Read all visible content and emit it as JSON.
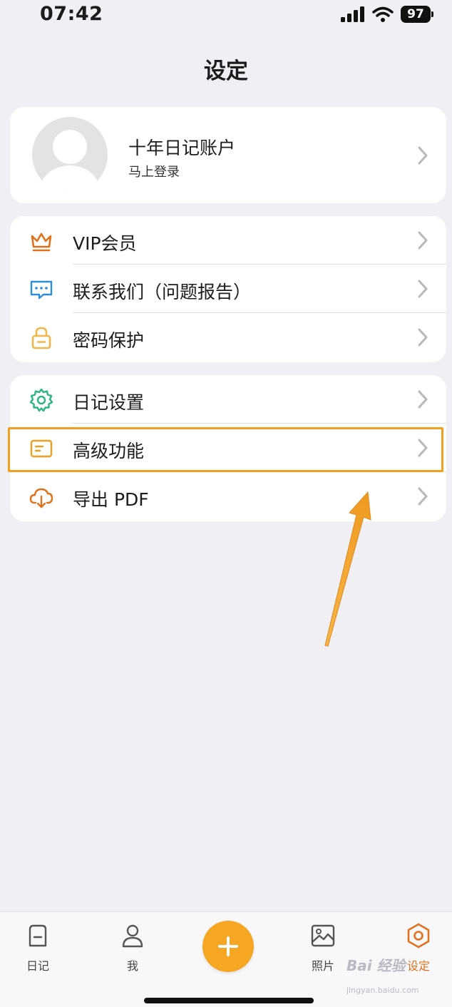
{
  "status_bar": {
    "time": "07:42",
    "battery": "97",
    "icons": [
      "signal-icon",
      "wifi-icon",
      "battery-icon"
    ]
  },
  "page_title": "设定",
  "profile": {
    "name": "十年日记账户",
    "subtitle": "马上登录"
  },
  "menu_group_1": [
    {
      "label": "VIP会员",
      "icon": "crown-icon",
      "color": "#e0721b"
    },
    {
      "label": "联系我们（问题报告）",
      "icon": "chat-bubble-icon",
      "color": "#2a8fd6"
    },
    {
      "label": "密码保护",
      "icon": "lock-icon",
      "color": "#f0b64a"
    }
  ],
  "menu_group_2": [
    {
      "label": "日记设置",
      "icon": "gear-icon",
      "color": "#2bb583"
    },
    {
      "label": "高级功能",
      "icon": "card-icon",
      "color": "#f0a01e"
    },
    {
      "label": "导出 PDF",
      "icon": "cloud-download-icon",
      "color": "#e0721b"
    }
  ],
  "tab_bar": {
    "tabs": [
      {
        "label": "日记",
        "icon": "diary-icon"
      },
      {
        "label": "我",
        "icon": "person-icon"
      },
      {
        "label": "",
        "icon": "plus-icon"
      },
      {
        "label": "照片",
        "icon": "photo-icon"
      },
      {
        "label": "设定",
        "icon": "hexagon-gear-icon",
        "active": true
      }
    ],
    "accent": "#f5a623",
    "active_color": "#e0721b"
  },
  "watermark": {
    "text": "Bai 经验",
    "sub": "jingyan.baidu.com"
  },
  "annotation_color": "#f0a01e"
}
